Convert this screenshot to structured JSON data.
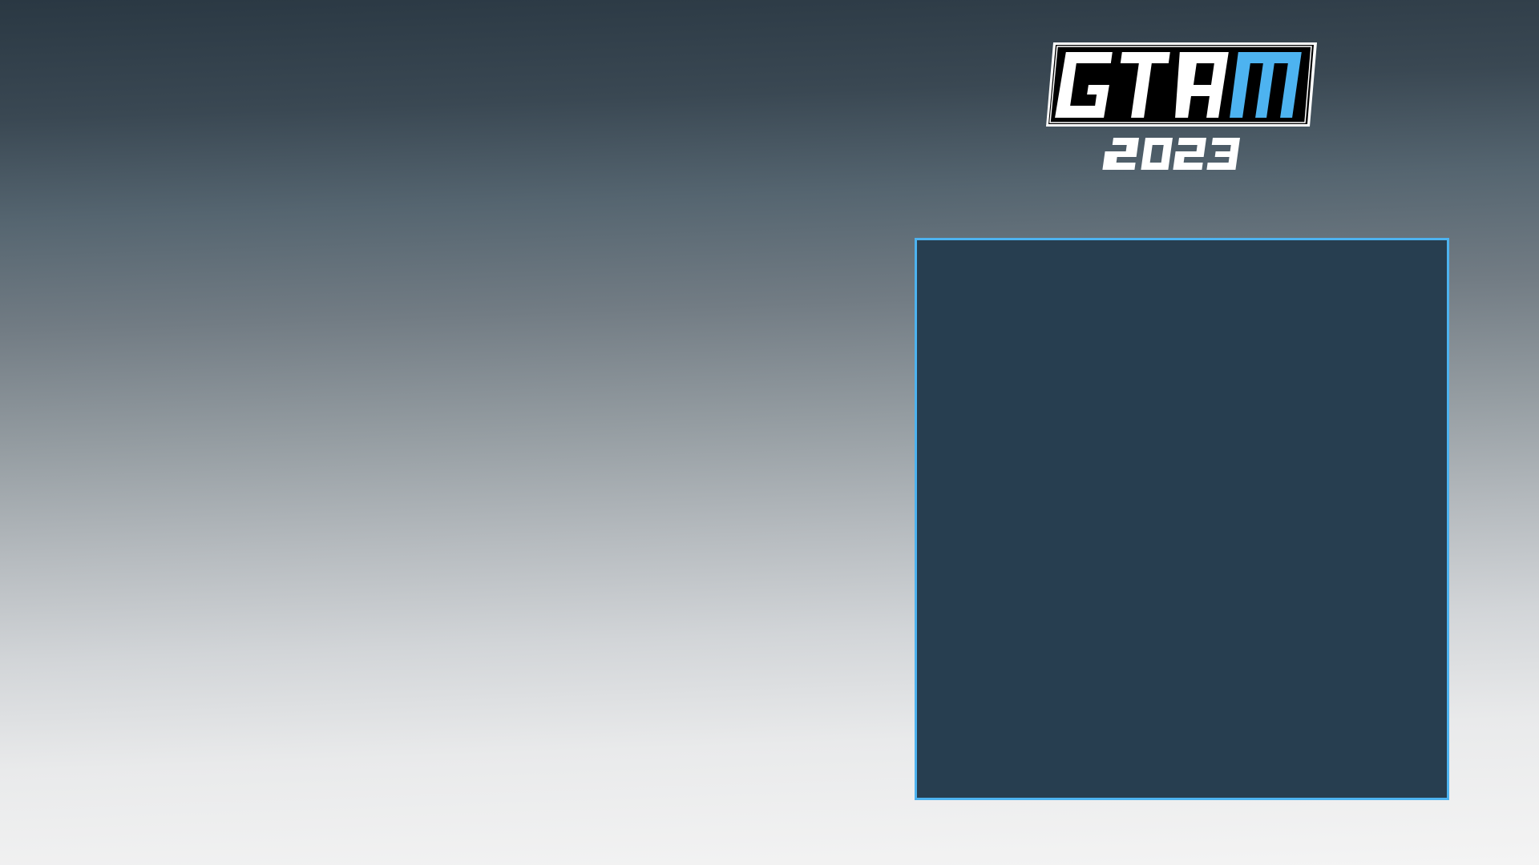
{
  "logo": {
    "letters": [
      "G",
      "T",
      "A",
      "M"
    ],
    "year": "2023",
    "colors": {
      "primary": "#ffffff",
      "accent": "#4db3f0",
      "badge_background": "#000000"
    }
  },
  "panel": {
    "background_color": "#273e50",
    "border_color": "#4db3f0"
  }
}
